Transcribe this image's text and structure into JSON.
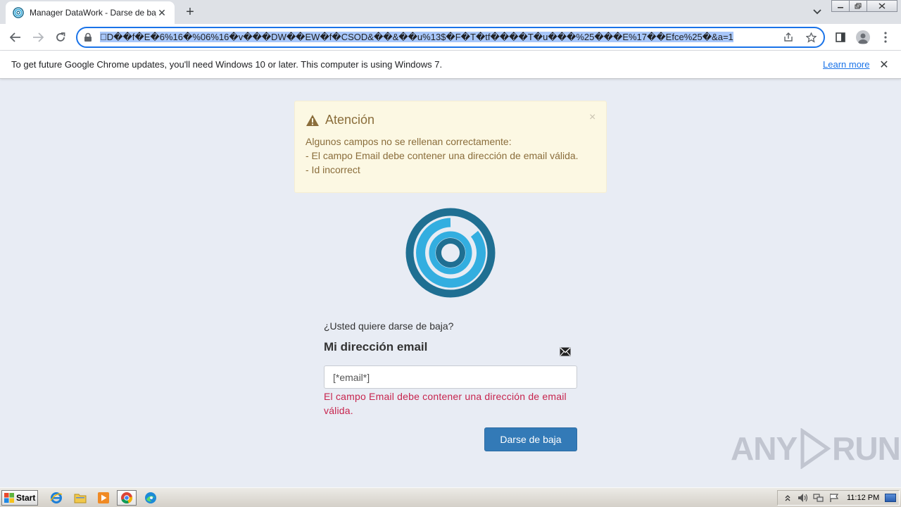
{
  "browser": {
    "tab": {
      "title": "Manager DataWork - Darse de baja"
    },
    "url": "\u0000D��f�E�6%16�%06%16�v���DW��EW�f�CSOD&��&��u%13$�F�T�tf����T�u���%25���E%17��Efce%25�&a=1",
    "infobar": {
      "message": "To get future Google Chrome updates, you'll need Windows 10 or later. This computer is using Windows 7.",
      "link": "Learn more"
    }
  },
  "alert": {
    "title": "Atención",
    "close": "×",
    "lines": [
      "Algunos campos no se rellenan correctamente:",
      "- El campo Email debe contener una dirección de email válida.",
      "- Id incorrect"
    ]
  },
  "form": {
    "question": "¿Usted quiere darse de baja?",
    "field_label": "Mi dirección email",
    "email_value": "[*email*]",
    "error": "El campo Email debe contener una dirección de email válida.",
    "submit_label": "Darse de baja"
  },
  "watermark": {
    "left": "ANY",
    "right": "RUN"
  },
  "taskbar": {
    "start_label": "Start",
    "clock": "11:12 PM"
  },
  "colors": {
    "accent": "#337ab7",
    "alert_bg": "#fcf8e3",
    "alert_text": "#8a6d3b",
    "error_text": "#c7254e",
    "logo_dark": "#1f6f92",
    "logo_light": "#33aee0"
  }
}
